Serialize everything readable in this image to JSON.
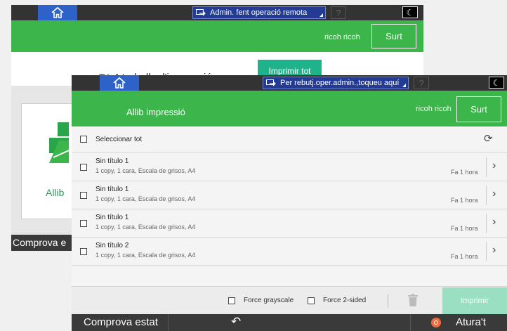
{
  "background_screen": {
    "remote_status": "Admin. fent operació remota",
    "help_label": "?",
    "night_label": "☾",
    "user": "ricoh ricoh",
    "exit_label": "Surt",
    "jobs_prefix": "Té ",
    "jobs_count": "4",
    "jobs_highlight": " treballs d'impressió",
    "jobs_suffix": " en espera",
    "print_all_label": "Imprimir tot",
    "card_label": "Allib",
    "status_label": "Comprova e"
  },
  "front_screen": {
    "remote_status": "Per rebutj.oper.admin.,toqueu aquí",
    "help_label": "?",
    "night_label": "☾",
    "title": "Allib impressió",
    "user": "ricoh ricoh",
    "exit_label": "Surt",
    "select_all_label": "Seleccionar tot",
    "jobs": [
      {
        "name": "Sin título 1",
        "detail": "1 copy, 1 cara, Escala de grisos, A4",
        "age": "Fa 1 hora"
      },
      {
        "name": "Sin título 1",
        "detail": "1 copy, 1 cara, Escala de grisos, A4",
        "age": "Fa 1 hora"
      },
      {
        "name": "Sin título 1",
        "detail": "1 copy, 1 cara, Escala de grisos, A4",
        "age": "Fa 1 hora"
      },
      {
        "name": "Sin título 2",
        "detail": "1 copy, 1 cara, Escala de grisos, A4",
        "age": "Fa 1 hora"
      }
    ],
    "force_grayscale_label": "Force grayscale",
    "force_2sided_label": "Force 2-sided",
    "print_label": "Imprimir",
    "status_bar": {
      "check_status_label": "Comprova estat",
      "back_icon": "↶",
      "stop_label": "Atura't"
    }
  },
  "colors": {
    "green": "#3cb64a",
    "teal": "#1fb38b",
    "teal_disabled": "#9bdfc2",
    "home_blue": "#2f62c9",
    "stop_orange": "#f06a3f"
  }
}
